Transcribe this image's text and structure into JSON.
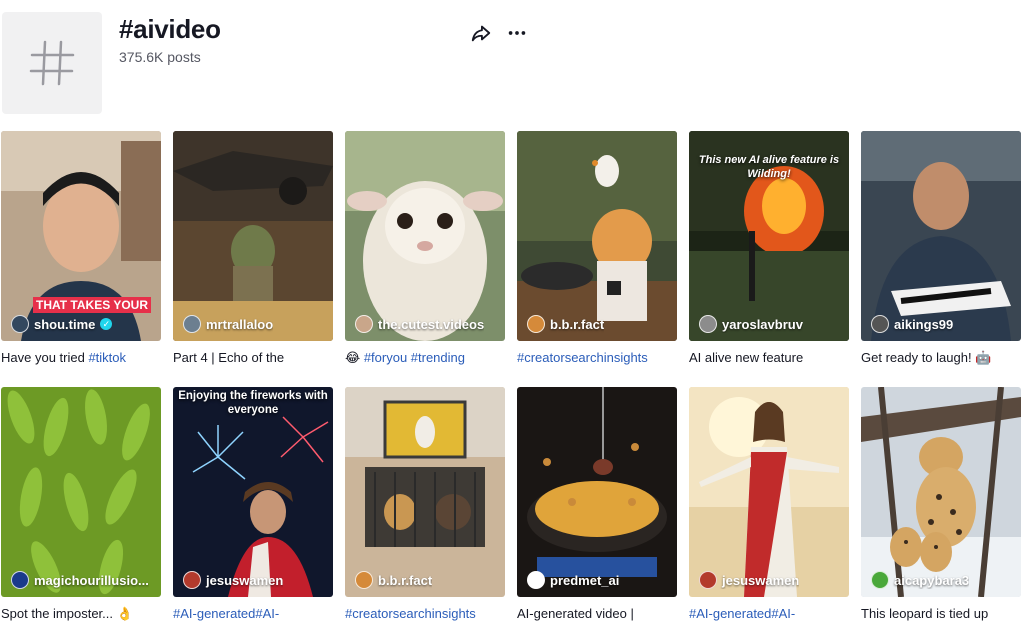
{
  "header": {
    "tag_title": "#aivideo",
    "posts_count": "375.6K posts",
    "hash_glyph": "#",
    "share_icon": "share-arrow-icon",
    "more_icon": "more-dots-icon"
  },
  "videos": [
    {
      "author": "shou.time",
      "verified": "✓",
      "overlay": "THAT TAKES YOUR",
      "caption_text": "Have you tried ",
      "caption_tag": "#tiktok"
    },
    {
      "author": "mrtrallaloo",
      "caption_text": "Part 4 | Echo of the",
      "caption_tag": ""
    },
    {
      "author": "the.cutest.videos",
      "caption_text": "😂 ",
      "caption_tag": "#foryou #trending"
    },
    {
      "author": "b.b.r.fact",
      "caption_text": "",
      "caption_tag": "#creatorsearchinsights"
    },
    {
      "author": "yaroslavbruv",
      "overlay": "This new AI alive feature is Wilding!",
      "caption_text": "AI alive new feature",
      "caption_tag": ""
    },
    {
      "author": "aikings99",
      "caption_text": "Get ready to laugh! 🤖",
      "caption_tag": ""
    },
    {
      "author": "magichourillusio...",
      "caption_text": "Spot the imposter... 👌",
      "caption_tag": ""
    },
    {
      "author": "jesuswamen",
      "overlay": "Enjoying the fireworks with everyone",
      "caption_text": "",
      "caption_tag": "#AI-generated#AI-"
    },
    {
      "author": "b.b.r.fact",
      "caption_text": "",
      "caption_tag": "#creatorsearchinsights"
    },
    {
      "author": "predmet_ai",
      "caption_text": "AI-generated video |",
      "caption_tag": ""
    },
    {
      "author": "jesuswamen",
      "caption_text": "",
      "caption_tag": "#AI-generated#AI-"
    },
    {
      "author": "aicapybara3",
      "caption_text": "This leopard is tied up",
      "caption_tag": ""
    }
  ],
  "colors": {
    "hashtag": "#2b5db9",
    "verified": "#20d5ec",
    "banner": "#e6304a"
  }
}
